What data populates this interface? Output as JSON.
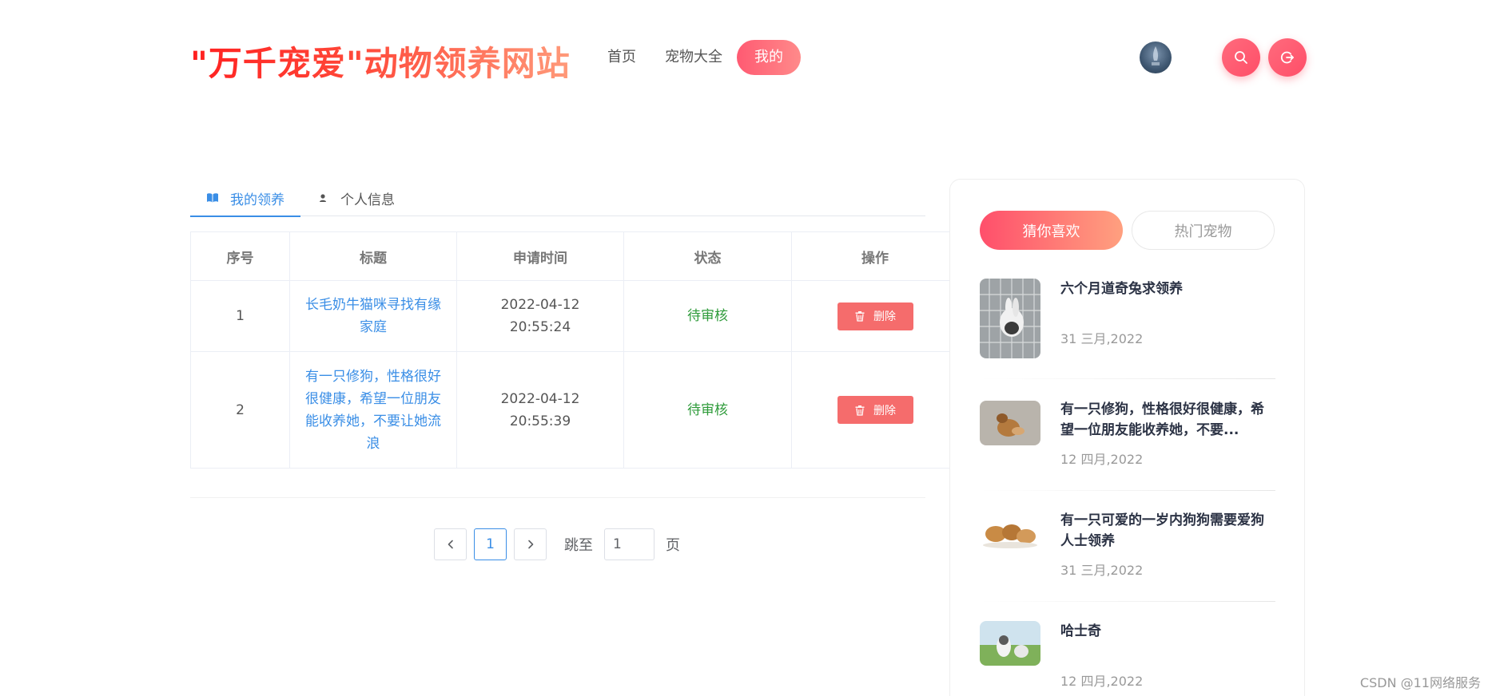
{
  "header": {
    "logo": "\"万千宠爱\"动物领养网站",
    "nav": [
      {
        "label": "首页",
        "active": false
      },
      {
        "label": "宠物大全",
        "active": false
      },
      {
        "label": "我的",
        "active": true
      }
    ],
    "icons": {
      "search": "search-icon",
      "logout": "logout-icon"
    }
  },
  "tabs": [
    {
      "label": "我的领养",
      "icon": "book-icon",
      "active": true
    },
    {
      "label": "个人信息",
      "icon": "user-icon",
      "active": false
    }
  ],
  "table": {
    "headers": [
      "序号",
      "标题",
      "申请时间",
      "状态",
      "操作"
    ],
    "rows": [
      {
        "index": "1",
        "title": "长毛奶牛猫咪寻找有缘家庭",
        "time": "2022-04-12 20:55:24",
        "status": "待审核",
        "action": "删除"
      },
      {
        "index": "2",
        "title": "有一只修狗，性格很好很健康，希望一位朋友能收养她，不要让她流浪",
        "time": "2022-04-12 20:55:39",
        "status": "待审核",
        "action": "删除"
      }
    ]
  },
  "pagination": {
    "current": "1",
    "jump_label": "跳至",
    "jump_value": "1",
    "page_label": "页"
  },
  "sidebar": {
    "tabs": [
      {
        "label": "猜你喜欢",
        "active": true
      },
      {
        "label": "热门宠物",
        "active": false
      }
    ],
    "items": [
      {
        "title": "六个月道奇兔求领养",
        "date": "31 三月,2022"
      },
      {
        "title": "有一只修狗，性格很好很健康，希望一位朋友能收养她，不要...",
        "date": "12 四月,2022"
      },
      {
        "title": "有一只可爱的一岁内狗狗需要爱狗人士领养",
        "date": "31 三月,2022"
      },
      {
        "title": "哈士奇",
        "date": "12 四月,2022"
      }
    ]
  },
  "watermark": "CSDN @11网络服务",
  "colors": {
    "accent": "#ff5a72",
    "link": "#3a8ee6",
    "status": "#2e9b3a",
    "danger": "#f56c6c"
  }
}
